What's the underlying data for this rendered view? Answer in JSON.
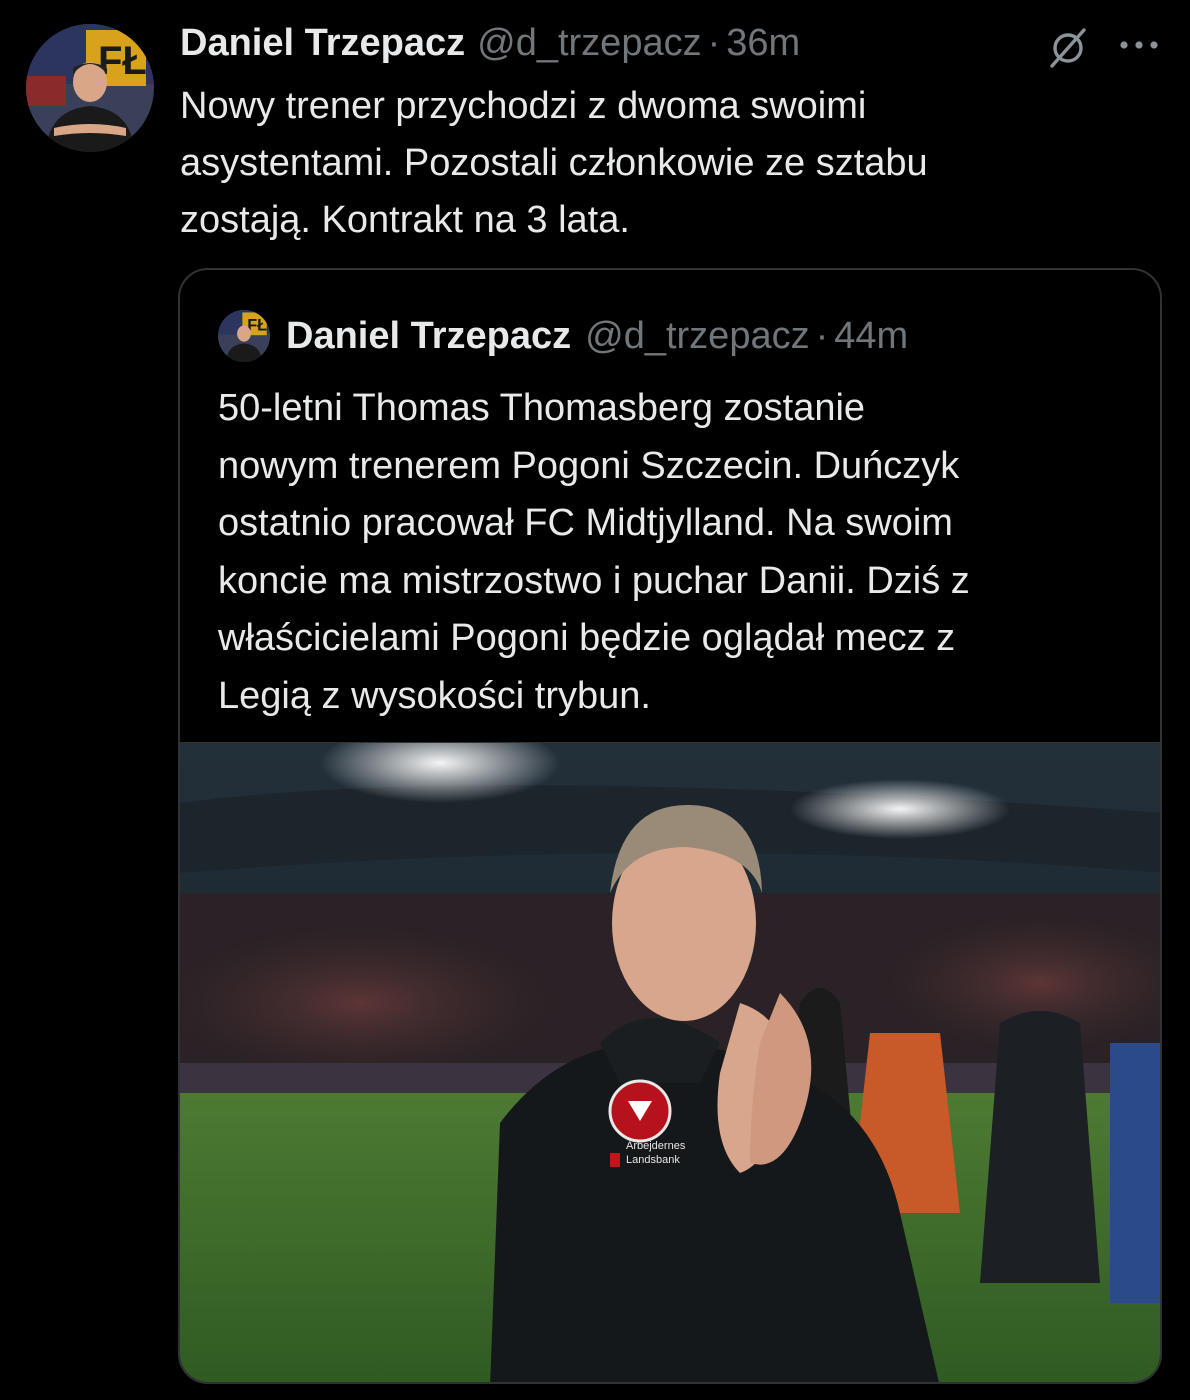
{
  "tweet": {
    "author": {
      "display_name": "Daniel Trzepacz",
      "handle": "@d_trzepacz",
      "avatar_icon": "user-avatar"
    },
    "separator": "·",
    "time": "36m",
    "text": "Nowy trener przychodzi z dwoma swoimi\nasystentami. Pozostali członkowie ze sztabu\nzostają. Kontrakt na 3 lata.",
    "actions": {
      "grok_icon": "grok-icon",
      "more_icon": "more-icon"
    }
  },
  "quoted_tweet": {
    "author": {
      "display_name": "Daniel Trzepacz",
      "handle": "@d_trzepacz",
      "avatar_icon": "user-avatar"
    },
    "separator": "·",
    "time": "44m",
    "text": "50-letni Thomas Thomasberg zostanie\nnowym trenerem Pogoni Szczecin. Duńczyk\nostatnio pracował FC Midtjylland. Na swoim\nkoncie ma mistrzostwo i puchar Danii. Dziś z\nwłaścicielami Pogoni będzie oglądał mecz z\nLegią z wysokości trybun.",
    "media": {
      "jacket_text_1": "Arbejdernes",
      "jacket_text_2": "Landsbank"
    }
  },
  "colors": {
    "background": "#000000",
    "primary_text": "#e7e9ea",
    "secondary_text": "#71767b",
    "border": "#2f3336"
  }
}
